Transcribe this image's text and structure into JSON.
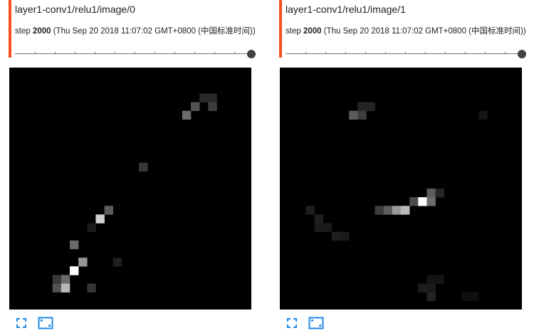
{
  "colors": {
    "accent": "#f4511e",
    "button": "#1e88e5"
  },
  "cards": [
    {
      "tag": "layer1-conv1/relu1/image/0",
      "dot": ".",
      "step_label": "step",
      "step_value": "2000",
      "timestamp": "(Thu Sep 20 2018 11:07:02 GMT+0800 (中国标准时间))",
      "slider_value": 1.0,
      "icons": {
        "expand": "fullscreen-icon",
        "fit": "fit-to-size-icon"
      },
      "image": {
        "grid": 28,
        "pixels": [
          [
            22,
            3,
            0.16
          ],
          [
            23,
            3,
            0.16
          ],
          [
            21,
            4,
            0.32
          ],
          [
            23,
            4,
            0.24
          ],
          [
            20,
            5,
            0.42
          ],
          [
            15,
            11,
            0.22
          ],
          [
            11,
            16,
            0.36
          ],
          [
            10,
            17,
            0.82
          ],
          [
            9,
            18,
            0.1
          ],
          [
            7,
            20,
            0.42
          ],
          [
            8,
            22,
            0.58
          ],
          [
            7,
            23,
            1.0
          ],
          [
            12,
            22,
            0.12
          ],
          [
            5,
            24,
            0.22
          ],
          [
            6,
            24,
            0.42
          ],
          [
            5,
            25,
            0.32
          ],
          [
            6,
            25,
            0.72
          ],
          [
            9,
            25,
            0.2
          ]
        ]
      }
    },
    {
      "tag": "layer1-conv1/relu1/image/1",
      "dot": ".",
      "step_label": "step",
      "step_value": "2000",
      "timestamp": "(Thu Sep 20 2018 11:07:02 GMT+0800 (中国标准时间))",
      "slider_value": 1.0,
      "icons": {
        "expand": "fullscreen-icon",
        "fit": "fit-to-size-icon"
      },
      "image": {
        "grid": 28,
        "pixels": [
          [
            9,
            4,
            0.14
          ],
          [
            10,
            4,
            0.14
          ],
          [
            8,
            5,
            0.36
          ],
          [
            9,
            5,
            0.24
          ],
          [
            23,
            5,
            0.08
          ],
          [
            17,
            14,
            0.36
          ],
          [
            18,
            14,
            0.14
          ],
          [
            15,
            15,
            0.3
          ],
          [
            16,
            15,
            1.0
          ],
          [
            17,
            15,
            0.42
          ],
          [
            11,
            16,
            0.24
          ],
          [
            12,
            16,
            0.36
          ],
          [
            13,
            16,
            0.6
          ],
          [
            14,
            16,
            0.72
          ],
          [
            3,
            16,
            0.12
          ],
          [
            4,
            17,
            0.12
          ],
          [
            4,
            18,
            0.1
          ],
          [
            5,
            18,
            0.1
          ],
          [
            6,
            19,
            0.12
          ],
          [
            7,
            19,
            0.1
          ],
          [
            17,
            24,
            0.08
          ],
          [
            18,
            24,
            0.08
          ],
          [
            16,
            25,
            0.12
          ],
          [
            17,
            25,
            0.1
          ],
          [
            17,
            26,
            0.14
          ],
          [
            21,
            26,
            0.06
          ],
          [
            22,
            26,
            0.06
          ]
        ]
      }
    }
  ]
}
